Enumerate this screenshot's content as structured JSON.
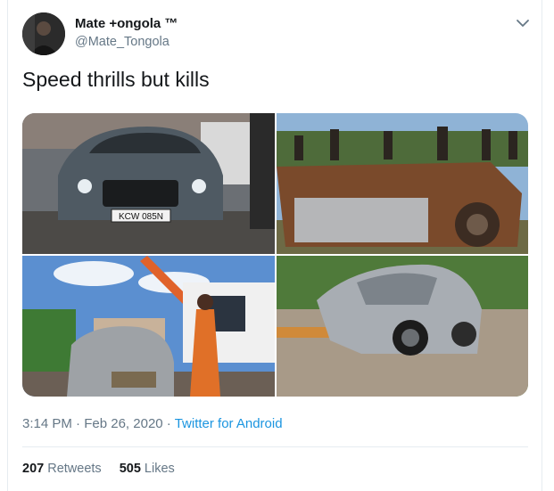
{
  "user": {
    "display_name": "Mate +ongola ™",
    "handle": "@Mate_Tongola"
  },
  "icons": {
    "avatar": "avatar",
    "caret": "chevron-down-icon"
  },
  "tweet": {
    "text": "Speed thrills but kills"
  },
  "media": {
    "plate_text": "KCW 085N"
  },
  "meta": {
    "time": "3:14 PM",
    "sep1": " · ",
    "date": "Feb 26, 2020",
    "sep2": " · ",
    "source": "Twitter for Android"
  },
  "stats": {
    "retweets_count": "207",
    "retweets_label": "Retweets",
    "likes_count": "505",
    "likes_label": "Likes"
  },
  "colors": {
    "link": "#1b95e0",
    "secondary_text": "#657786",
    "border": "#e6ecf0"
  }
}
